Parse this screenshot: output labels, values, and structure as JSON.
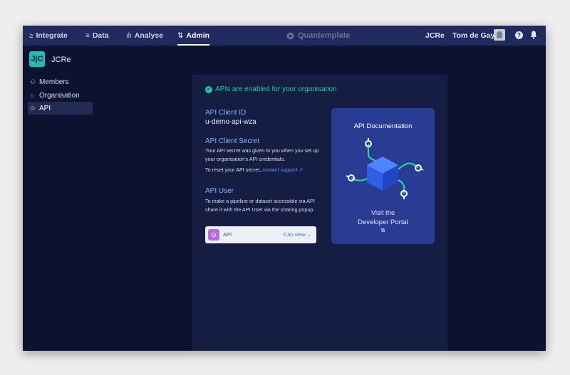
{
  "topbar": {
    "nav": [
      {
        "icon": "integrate-icon",
        "glyph": "≥",
        "label": "Integrate"
      },
      {
        "icon": "data-icon",
        "glyph": "≡",
        "label": "Data"
      },
      {
        "icon": "analyse-icon",
        "glyph": "ılı",
        "label": "Analyse"
      },
      {
        "icon": "admin-icon",
        "glyph": "⇅",
        "label": "Admin"
      }
    ],
    "brand": "Quantemplate",
    "org_code": "JCRe",
    "user_name": "Tom de Gay",
    "help_glyph": "?"
  },
  "sidebar": {
    "org_logo": "J|C",
    "org_name": "JCRe",
    "items": [
      {
        "icon": "members-icon",
        "glyph": "⚇",
        "label": "Members"
      },
      {
        "icon": "organisation-icon",
        "glyph": "⌂",
        "label": "Organisation"
      },
      {
        "icon": "api-icon",
        "glyph": "⊙",
        "label": "API"
      }
    ]
  },
  "api": {
    "status": "APIs are enabled for your organisation",
    "client_id_title": "API Client ID",
    "client_id_value": "u-demo-api-wza",
    "secret_title": "API Client Secret",
    "secret_text": "Your API secret was given to you when you set up your organisation's API credentials.",
    "reset_prefix": "To reset your API secret,",
    "reset_link": "contact support",
    "user_title": "API User",
    "user_text": "To make a pipeline or dataset accessible via API share it with the API User via the sharing popup.",
    "share_label": "API",
    "share_permission": "Can view ⌄",
    "doc_title": "API Documentation",
    "doc_visit_line1": "Visit the",
    "doc_visit_line2": "Developer Portal"
  },
  "colors": {
    "accent": "#26c7a8",
    "link": "#5c9bff",
    "topbar": "#1f2a5e",
    "card": "#2a3b93"
  }
}
